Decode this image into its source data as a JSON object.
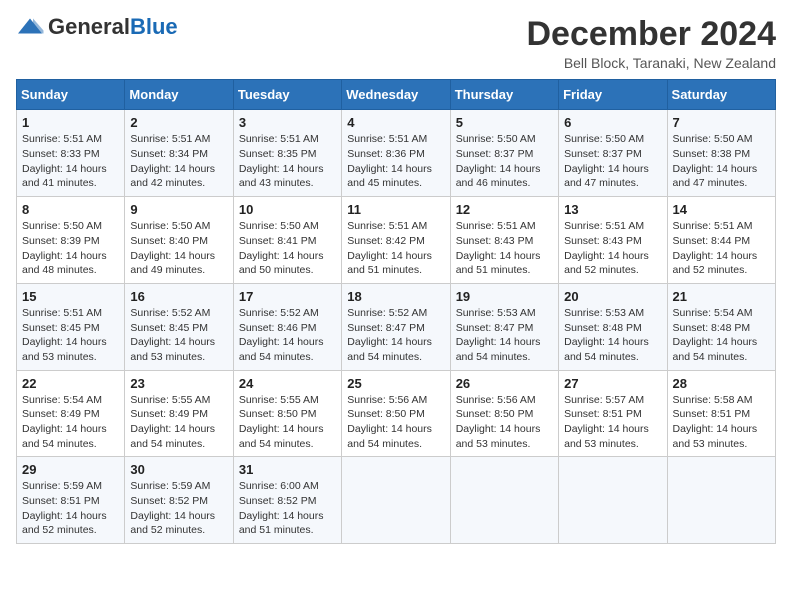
{
  "header": {
    "logo_general": "General",
    "logo_blue": "Blue",
    "month_title": "December 2024",
    "location": "Bell Block, Taranaki, New Zealand"
  },
  "weekdays": [
    "Sunday",
    "Monday",
    "Tuesday",
    "Wednesday",
    "Thursday",
    "Friday",
    "Saturday"
  ],
  "weeks": [
    [
      {
        "day": "1",
        "sunrise": "5:51 AM",
        "sunset": "8:33 PM",
        "daylight": "14 hours and 41 minutes."
      },
      {
        "day": "2",
        "sunrise": "5:51 AM",
        "sunset": "8:34 PM",
        "daylight": "14 hours and 42 minutes."
      },
      {
        "day": "3",
        "sunrise": "5:51 AM",
        "sunset": "8:35 PM",
        "daylight": "14 hours and 43 minutes."
      },
      {
        "day": "4",
        "sunrise": "5:51 AM",
        "sunset": "8:36 PM",
        "daylight": "14 hours and 45 minutes."
      },
      {
        "day": "5",
        "sunrise": "5:50 AM",
        "sunset": "8:37 PM",
        "daylight": "14 hours and 46 minutes."
      },
      {
        "day": "6",
        "sunrise": "5:50 AM",
        "sunset": "8:37 PM",
        "daylight": "14 hours and 47 minutes."
      },
      {
        "day": "7",
        "sunrise": "5:50 AM",
        "sunset": "8:38 PM",
        "daylight": "14 hours and 47 minutes."
      }
    ],
    [
      {
        "day": "8",
        "sunrise": "5:50 AM",
        "sunset": "8:39 PM",
        "daylight": "14 hours and 48 minutes."
      },
      {
        "day": "9",
        "sunrise": "5:50 AM",
        "sunset": "8:40 PM",
        "daylight": "14 hours and 49 minutes."
      },
      {
        "day": "10",
        "sunrise": "5:50 AM",
        "sunset": "8:41 PM",
        "daylight": "14 hours and 50 minutes."
      },
      {
        "day": "11",
        "sunrise": "5:51 AM",
        "sunset": "8:42 PM",
        "daylight": "14 hours and 51 minutes."
      },
      {
        "day": "12",
        "sunrise": "5:51 AM",
        "sunset": "8:43 PM",
        "daylight": "14 hours and 51 minutes."
      },
      {
        "day": "13",
        "sunrise": "5:51 AM",
        "sunset": "8:43 PM",
        "daylight": "14 hours and 52 minutes."
      },
      {
        "day": "14",
        "sunrise": "5:51 AM",
        "sunset": "8:44 PM",
        "daylight": "14 hours and 52 minutes."
      }
    ],
    [
      {
        "day": "15",
        "sunrise": "5:51 AM",
        "sunset": "8:45 PM",
        "daylight": "14 hours and 53 minutes."
      },
      {
        "day": "16",
        "sunrise": "5:52 AM",
        "sunset": "8:45 PM",
        "daylight": "14 hours and 53 minutes."
      },
      {
        "day": "17",
        "sunrise": "5:52 AM",
        "sunset": "8:46 PM",
        "daylight": "14 hours and 54 minutes."
      },
      {
        "day": "18",
        "sunrise": "5:52 AM",
        "sunset": "8:47 PM",
        "daylight": "14 hours and 54 minutes."
      },
      {
        "day": "19",
        "sunrise": "5:53 AM",
        "sunset": "8:47 PM",
        "daylight": "14 hours and 54 minutes."
      },
      {
        "day": "20",
        "sunrise": "5:53 AM",
        "sunset": "8:48 PM",
        "daylight": "14 hours and 54 minutes."
      },
      {
        "day": "21",
        "sunrise": "5:54 AM",
        "sunset": "8:48 PM",
        "daylight": "14 hours and 54 minutes."
      }
    ],
    [
      {
        "day": "22",
        "sunrise": "5:54 AM",
        "sunset": "8:49 PM",
        "daylight": "14 hours and 54 minutes."
      },
      {
        "day": "23",
        "sunrise": "5:55 AM",
        "sunset": "8:49 PM",
        "daylight": "14 hours and 54 minutes."
      },
      {
        "day": "24",
        "sunrise": "5:55 AM",
        "sunset": "8:50 PM",
        "daylight": "14 hours and 54 minutes."
      },
      {
        "day": "25",
        "sunrise": "5:56 AM",
        "sunset": "8:50 PM",
        "daylight": "14 hours and 54 minutes."
      },
      {
        "day": "26",
        "sunrise": "5:56 AM",
        "sunset": "8:50 PM",
        "daylight": "14 hours and 53 minutes."
      },
      {
        "day": "27",
        "sunrise": "5:57 AM",
        "sunset": "8:51 PM",
        "daylight": "14 hours and 53 minutes."
      },
      {
        "day": "28",
        "sunrise": "5:58 AM",
        "sunset": "8:51 PM",
        "daylight": "14 hours and 53 minutes."
      }
    ],
    [
      {
        "day": "29",
        "sunrise": "5:59 AM",
        "sunset": "8:51 PM",
        "daylight": "14 hours and 52 minutes."
      },
      {
        "day": "30",
        "sunrise": "5:59 AM",
        "sunset": "8:52 PM",
        "daylight": "14 hours and 52 minutes."
      },
      {
        "day": "31",
        "sunrise": "6:00 AM",
        "sunset": "8:52 PM",
        "daylight": "14 hours and 51 minutes."
      },
      null,
      null,
      null,
      null
    ]
  ],
  "labels": {
    "sunrise": "Sunrise:",
    "sunset": "Sunset:",
    "daylight": "Daylight:"
  }
}
